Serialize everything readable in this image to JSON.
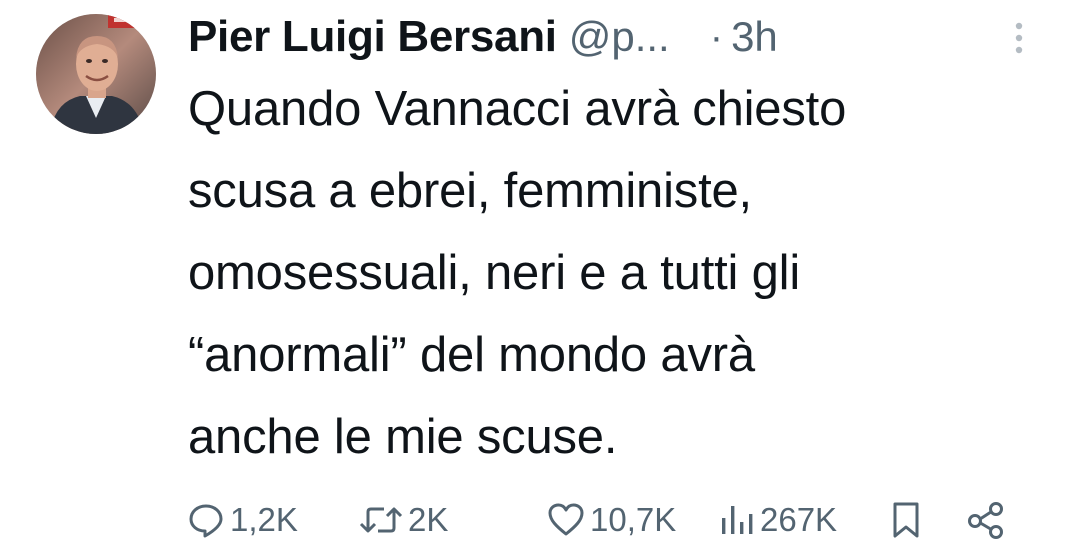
{
  "author": {
    "display_name": "Pier Luigi Bersani",
    "handle": "@p...",
    "separator": "·",
    "time": "3h"
  },
  "tweet": {
    "lines": [
      "Quando Vannacci avrà chiesto",
      "scusa a ebrei, femministe,",
      "omosessuali, neri e a tutti gli",
      "“anormali” del mondo avrà",
      "anche le mie scuse."
    ]
  },
  "actions": {
    "replies": "1,2K",
    "retweets": "2K",
    "likes": "10,7K",
    "views": "267K"
  },
  "icons": {
    "reply": "speech-bubble-icon",
    "retweet": "retweet-arrows-icon",
    "like": "heart-icon",
    "views": "bar-chart-icon",
    "bookmark": "bookmark-icon",
    "share": "share-nodes-icon",
    "more": "vertical-dots-icon"
  },
  "colors": {
    "text_primary": "#0f1419",
    "text_secondary": "#536471"
  }
}
